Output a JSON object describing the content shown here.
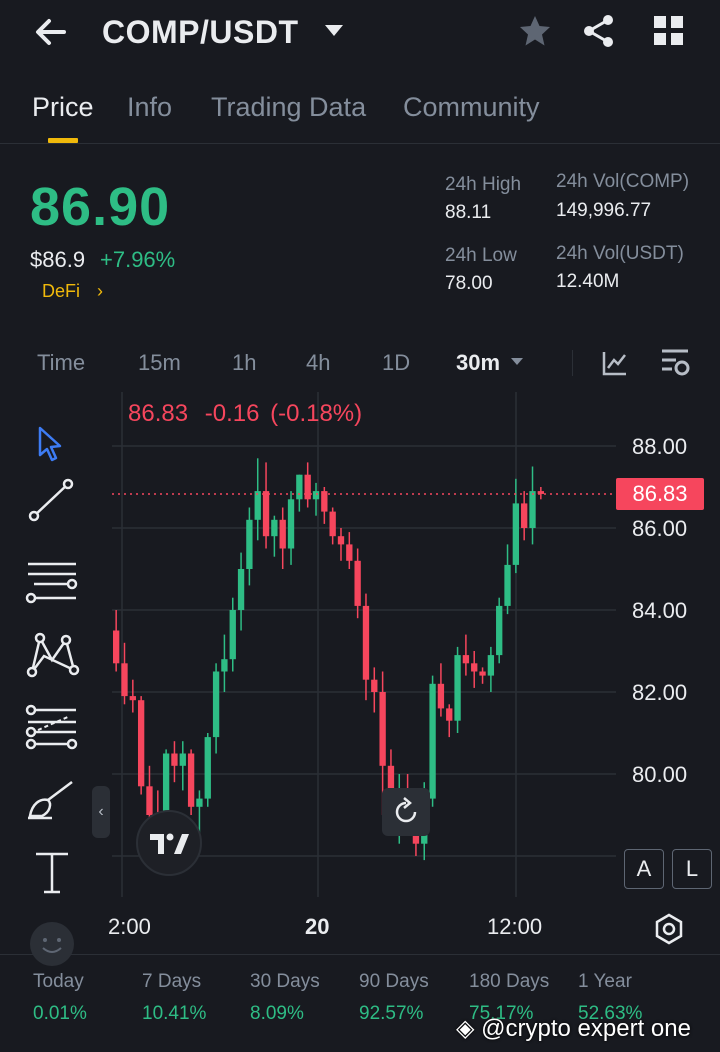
{
  "header": {
    "pair": "COMP/USDT",
    "back_icon": "arrow-left-icon",
    "dropdown_icon": "caret-down-icon",
    "star_icon": "star-icon",
    "share_icon": "share-icon",
    "grid_icon": "grid-icon"
  },
  "tabs": [
    {
      "label": "Price",
      "active": true
    },
    {
      "label": "Info"
    },
    {
      "label": "Trading Data"
    },
    {
      "label": "Community"
    }
  ],
  "ticker": {
    "last_price": "86.90",
    "usd_price": "$86.9",
    "change_pct": "+7.96%",
    "tag": "DeFi",
    "high_label": "24h High",
    "high": "88.11",
    "low_label": "24h Low",
    "low": "78.00",
    "vol_base_label": "24h Vol(COMP)",
    "vol_base": "149,996.77",
    "vol_quote_label": "24h Vol(USDT)",
    "vol_quote": "12.40M"
  },
  "intervals": {
    "items": [
      "Time",
      "15m",
      "1h",
      "4h",
      "1D",
      "30m"
    ],
    "active": "30m"
  },
  "chart": {
    "ohlc_price": "86.83",
    "ohlc_change": "-0.16",
    "ohlc_change_pct": "(-0.18%)",
    "current_price_tag": "86.83",
    "ohl_buttons": [
      "A",
      "L"
    ]
  },
  "chart_data": {
    "type": "candlestick",
    "ylim": [
      77.5,
      89.0
    ],
    "y_ticks": [
      "88.00",
      "86.00",
      "84.00",
      "82.00",
      "80.00"
    ],
    "x_ticks": [
      "2:00",
      "20",
      "12:00"
    ],
    "current_price": 86.83,
    "colors": {
      "up": "#2ebd85",
      "down": "#f6465d"
    },
    "candles": [
      [
        83.5,
        84.0,
        82.5,
        82.7
      ],
      [
        82.7,
        83.2,
        81.7,
        81.9
      ],
      [
        81.9,
        82.3,
        81.5,
        81.8
      ],
      [
        81.8,
        81.9,
        79.5,
        79.7
      ],
      [
        79.7,
        80.2,
        78.9,
        79.0
      ],
      [
        79.0,
        79.6,
        77.9,
        78.2
      ],
      [
        78.2,
        80.6,
        77.6,
        80.5
      ],
      [
        80.5,
        80.8,
        79.8,
        80.2
      ],
      [
        80.2,
        80.8,
        79.6,
        80.5
      ],
      [
        80.5,
        80.6,
        79.0,
        79.2
      ],
      [
        79.2,
        79.6,
        78.4,
        79.4
      ],
      [
        79.4,
        81.0,
        79.2,
        80.9
      ],
      [
        80.9,
        82.7,
        80.5,
        82.5
      ],
      [
        82.5,
        83.4,
        82.0,
        82.8
      ],
      [
        82.8,
        84.3,
        82.5,
        84.0
      ],
      [
        84.0,
        85.4,
        83.5,
        85.0
      ],
      [
        85.0,
        86.5,
        84.6,
        86.2
      ],
      [
        86.2,
        87.7,
        85.7,
        86.9
      ],
      [
        86.9,
        87.6,
        85.5,
        85.8
      ],
      [
        85.8,
        86.3,
        85.3,
        86.2
      ],
      [
        86.2,
        86.5,
        85.0,
        85.5
      ],
      [
        85.5,
        86.9,
        85.1,
        86.7
      ],
      [
        86.7,
        87.3,
        86.4,
        87.3
      ],
      [
        87.3,
        87.6,
        86.5,
        86.7
      ],
      [
        86.7,
        87.1,
        86.3,
        86.9
      ],
      [
        86.9,
        87.0,
        86.1,
        86.4
      ],
      [
        86.4,
        86.5,
        85.6,
        85.8
      ],
      [
        85.8,
        86.0,
        85.2,
        85.6
      ],
      [
        85.6,
        85.9,
        85.0,
        85.2
      ],
      [
        85.2,
        85.5,
        83.8,
        84.1
      ],
      [
        84.1,
        84.4,
        81.8,
        82.3
      ],
      [
        82.3,
        82.6,
        81.5,
        82.0
      ],
      [
        82.0,
        82.5,
        79.0,
        80.2
      ],
      [
        80.2,
        80.6,
        78.8,
        79.1
      ],
      [
        79.1,
        80.0,
        78.3,
        79.6
      ],
      [
        79.6,
        80.0,
        78.9,
        79.3
      ],
      [
        79.3,
        79.5,
        78.0,
        78.3
      ],
      [
        78.3,
        79.8,
        77.9,
        79.4
      ],
      [
        79.4,
        82.4,
        79.2,
        82.2
      ],
      [
        82.2,
        82.7,
        81.4,
        81.6
      ],
      [
        81.6,
        81.7,
        80.9,
        81.3
      ],
      [
        81.3,
        83.1,
        81.0,
        82.9
      ],
      [
        82.9,
        83.4,
        82.4,
        82.7
      ],
      [
        82.7,
        83.0,
        82.1,
        82.5
      ],
      [
        82.5,
        82.6,
        82.2,
        82.4
      ],
      [
        82.4,
        83.1,
        82.0,
        82.9
      ],
      [
        82.9,
        84.3,
        82.7,
        84.1
      ],
      [
        84.1,
        85.6,
        83.9,
        85.1
      ],
      [
        85.1,
        87.2,
        84.9,
        86.6
      ],
      [
        86.6,
        86.9,
        85.7,
        86.0
      ],
      [
        86.0,
        87.5,
        85.6,
        86.9
      ],
      [
        86.9,
        87.0,
        86.7,
        86.83
      ]
    ]
  },
  "performance": [
    {
      "label": "Today",
      "value": "0.01%"
    },
    {
      "label": "7 Days",
      "value": "10.41%"
    },
    {
      "label": "30 Days",
      "value": "8.09%"
    },
    {
      "label": "90 Days",
      "value": "92.57%"
    },
    {
      "label": "180 Days",
      "value": "75.17%"
    },
    {
      "label": "1 Year",
      "value": "52.63%"
    }
  ],
  "watermark": "@crypto expert one",
  "tools": [
    "cursor-icon",
    "trend-line-icon",
    "horizontal-lines-icon",
    "pattern-icon",
    "fib-lines-icon",
    "brush-icon",
    "text-tool-icon"
  ]
}
